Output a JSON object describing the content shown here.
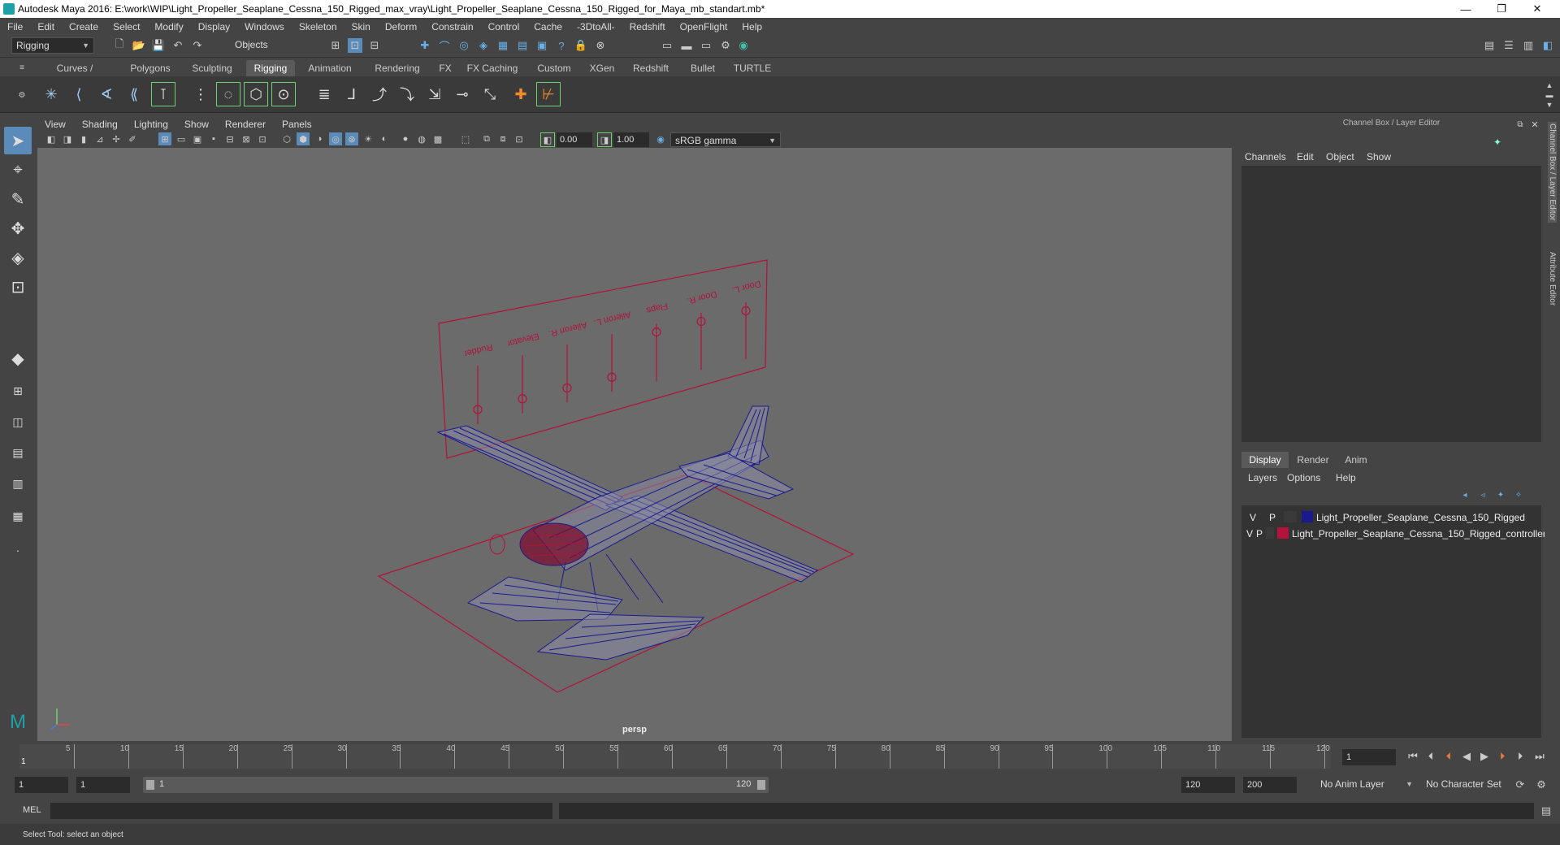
{
  "window": {
    "title": "Autodesk Maya 2016: E:\\work\\WIP\\Light_Propeller_Seaplane_Cessna_150_Rigged_max_vray\\Light_Propeller_Seaplane_Cessna_150_Rigged_for_Maya_mb_standart.mb*",
    "minimize": "—",
    "restore": "❐",
    "close": "✕"
  },
  "menubar": [
    "File",
    "Edit",
    "Create",
    "Select",
    "Modify",
    "Display",
    "Windows",
    "Skeleton",
    "Skin",
    "Deform",
    "Constrain",
    "Control",
    "Cache",
    "-3DtoAll-",
    "Redshift",
    "OpenFlight",
    "Help"
  ],
  "statusline": {
    "mode": "Rigging",
    "selection_mode": "Objects"
  },
  "shelf_tabs": {
    "items": [
      "Curves / Surfaces",
      "Polygons",
      "Sculpting",
      "Rigging",
      "Animation",
      "Rendering",
      "FX",
      "FX Caching",
      "Custom",
      "XGen",
      "Redshift",
      "Bullet",
      "TURTLE"
    ],
    "active": "Rigging"
  },
  "viewport": {
    "menu": [
      "View",
      "Shading",
      "Lighting",
      "Show",
      "Renderer",
      "Panels"
    ],
    "exposure": "0.00",
    "gamma": "1.00",
    "color_space": "sRGB gamma",
    "camera": "persp",
    "controller_labels": [
      "Rudder",
      "Elevator",
      "Aileron R.",
      "Aileron L.",
      "Flaps",
      "Door R.",
      "Door L."
    ],
    "colors": {
      "mesh": "#1a1a8c",
      "controller": "#b3123a",
      "background": "#6b6b6b"
    }
  },
  "channel_box": {
    "title": "Channel Box / Layer Editor",
    "menu": [
      "Channels",
      "Edit",
      "Object",
      "Show"
    ]
  },
  "layer_editor": {
    "tabs": [
      "Display",
      "Render",
      "Anim"
    ],
    "active_tab": "Display",
    "menu": [
      "Layers",
      "Options",
      "Help"
    ],
    "layers": [
      {
        "v": "V",
        "p": "P",
        "name": "Light_Propeller_Seaplane_Cessna_150_Rigged",
        "color": "#1a1a8c"
      },
      {
        "v": "V",
        "p": "P",
        "name": "Light_Propeller_Seaplane_Cessna_150_Rigged_controller",
        "color": "#b3123a"
      }
    ]
  },
  "side_tabs": {
    "channel": "Channel Box / Layer Editor",
    "attribute": "Attribute Editor"
  },
  "timeline": {
    "ticks": [
      "5",
      "10",
      "15",
      "20",
      "25",
      "30",
      "35",
      "40",
      "45",
      "50",
      "55",
      "60",
      "65",
      "70",
      "75",
      "80",
      "85",
      "90",
      "95",
      "100",
      "105",
      "110",
      "115",
      "120"
    ],
    "start_marker": "1",
    "current_frame": "1"
  },
  "range": {
    "start": "1",
    "playback_start": "1",
    "slider_start": "1",
    "slider_end": "120",
    "playback_end": "120",
    "end": "200",
    "anim_layer": "No Anim Layer",
    "character_set": "No Character Set"
  },
  "command_line": {
    "label": "MEL"
  },
  "help_line": {
    "text": "Select Tool: select an object"
  }
}
